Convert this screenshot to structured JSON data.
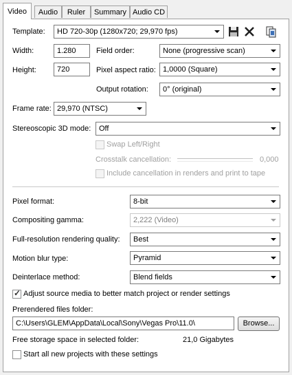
{
  "tabs": [
    "Video",
    "Audio",
    "Ruler",
    "Summary",
    "Audio CD"
  ],
  "template": {
    "label": "Template:",
    "value": "HD 720-30p (1280x720; 29,970 fps)"
  },
  "icons": {
    "save": "save-icon",
    "delete": "delete-icon",
    "match_media": "match-media-icon"
  },
  "width": {
    "label": "Width:",
    "value": "1.280"
  },
  "height": {
    "label": "Height:",
    "value": "720"
  },
  "field_order": {
    "label": "Field order:",
    "value": "None (progressive scan)"
  },
  "pixel_aspect": {
    "label": "Pixel aspect ratio:",
    "value": "1,0000 (Square)"
  },
  "output_rotation": {
    "label": "Output rotation:",
    "value": "0° (original)"
  },
  "frame_rate": {
    "label": "Frame rate:",
    "value": "29,970 (NTSC)"
  },
  "stereo": {
    "label": "Stereoscopic 3D mode:",
    "value": "Off"
  },
  "swap": {
    "label": "Swap Left/Right",
    "checked": false
  },
  "crosstalk": {
    "label": "Crosstalk cancellation:",
    "value": "0,000"
  },
  "include_cancel": {
    "label": "Include cancellation in renders and print to tape",
    "checked": false
  },
  "pixel_format": {
    "label": "Pixel format:",
    "value": "8-bit"
  },
  "compositing_gamma": {
    "label": "Compositing gamma:",
    "value": "2,222 (Video)"
  },
  "render_quality": {
    "label": "Full-resolution rendering quality:",
    "value": "Best"
  },
  "motion_blur": {
    "label": "Motion blur type:",
    "value": "Pyramid"
  },
  "deinterlace": {
    "label": "Deinterlace method:",
    "value": "Blend fields"
  },
  "adjust_media": {
    "label": "Adjust source media to better match project or render settings",
    "checked": true
  },
  "prerender": {
    "label": "Prerendered files folder:",
    "value": "C:\\Users\\GLEM\\AppData\\Local\\Sony\\Vegas Pro\\11.0\\",
    "browse": "Browse..."
  },
  "free_space": {
    "label": "Free storage space in selected folder:",
    "value": "21,0 Gigabytes"
  },
  "start_new": {
    "label": "Start all new projects with these settings",
    "checked": false
  }
}
